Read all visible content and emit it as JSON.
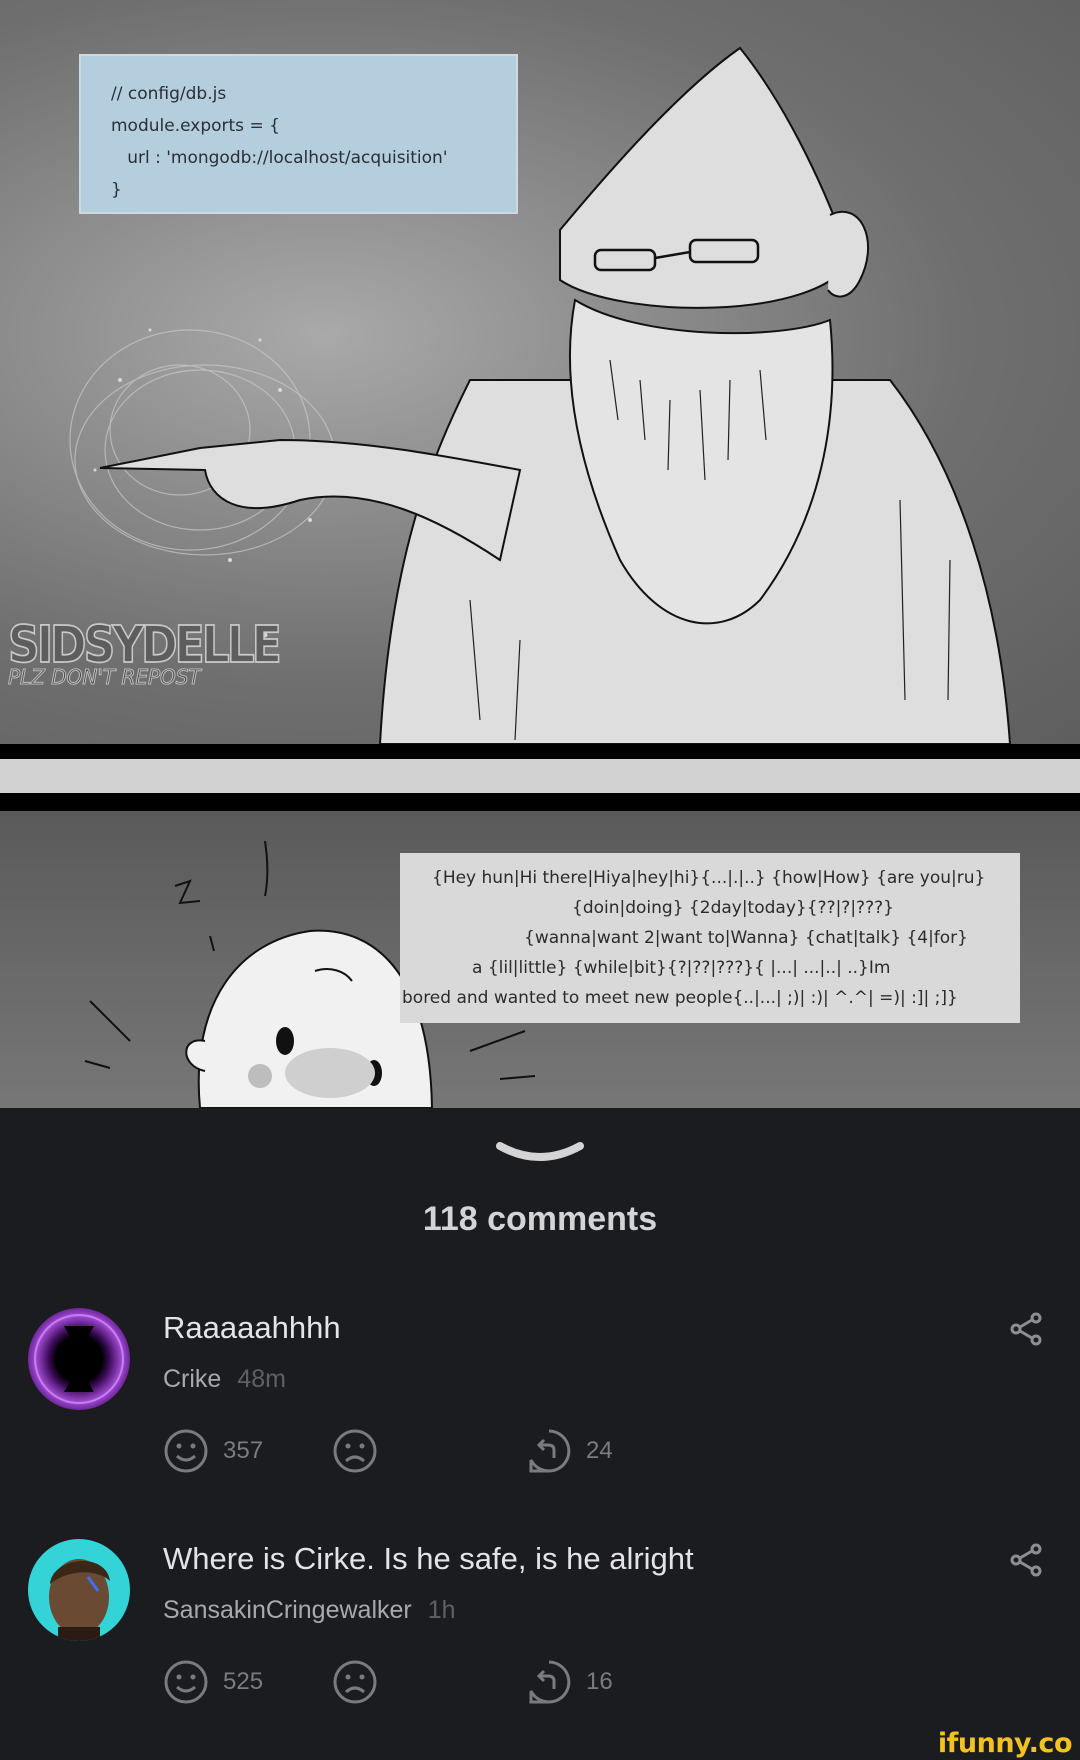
{
  "panel1": {
    "code_lines": [
      "// config/db.js",
      "module.exports = {",
      "   url : 'mongodb://localhost/acquisition'",
      "}"
    ],
    "watermark_name": "SIDSYDELLE",
    "watermark_sub": "PLZ DON'T REPOST"
  },
  "panel2": {
    "text_lines": [
      "{Hey hun|Hi there|Hiya|hey|hi}{...|.|..} {how|How} {are you|ru}",
      "{doin|doing} {2day|today}{??|?|???}",
      "{wanna|want 2|want to|Wanna} {chat|talk} {4|for}",
      "a {lil|little} {while|bit}{?|??|???}{ |...| ...|..| ..}Im",
      "bored and wanted to meet new people{..|...| ;)| :)| ^.^| =)| :]| ;]}"
    ]
  },
  "comments_header": {
    "count_label": "118 comments"
  },
  "comments": [
    {
      "text": "Raaaaahhhh",
      "user": "Crike",
      "time": "48m",
      "smile_count": "357",
      "reply_count": "24"
    },
    {
      "text": "Where is Cirke. Is he safe, is he alright",
      "user": "SansakinCringewalker",
      "time": "1h",
      "smile_count": "525",
      "reply_count": "16"
    }
  ],
  "branding": {
    "logo_text": "ifunny.co"
  },
  "colors": {
    "background": "#1b1c20",
    "brand": "#f4c21f",
    "note_blue": "#b4cede"
  }
}
